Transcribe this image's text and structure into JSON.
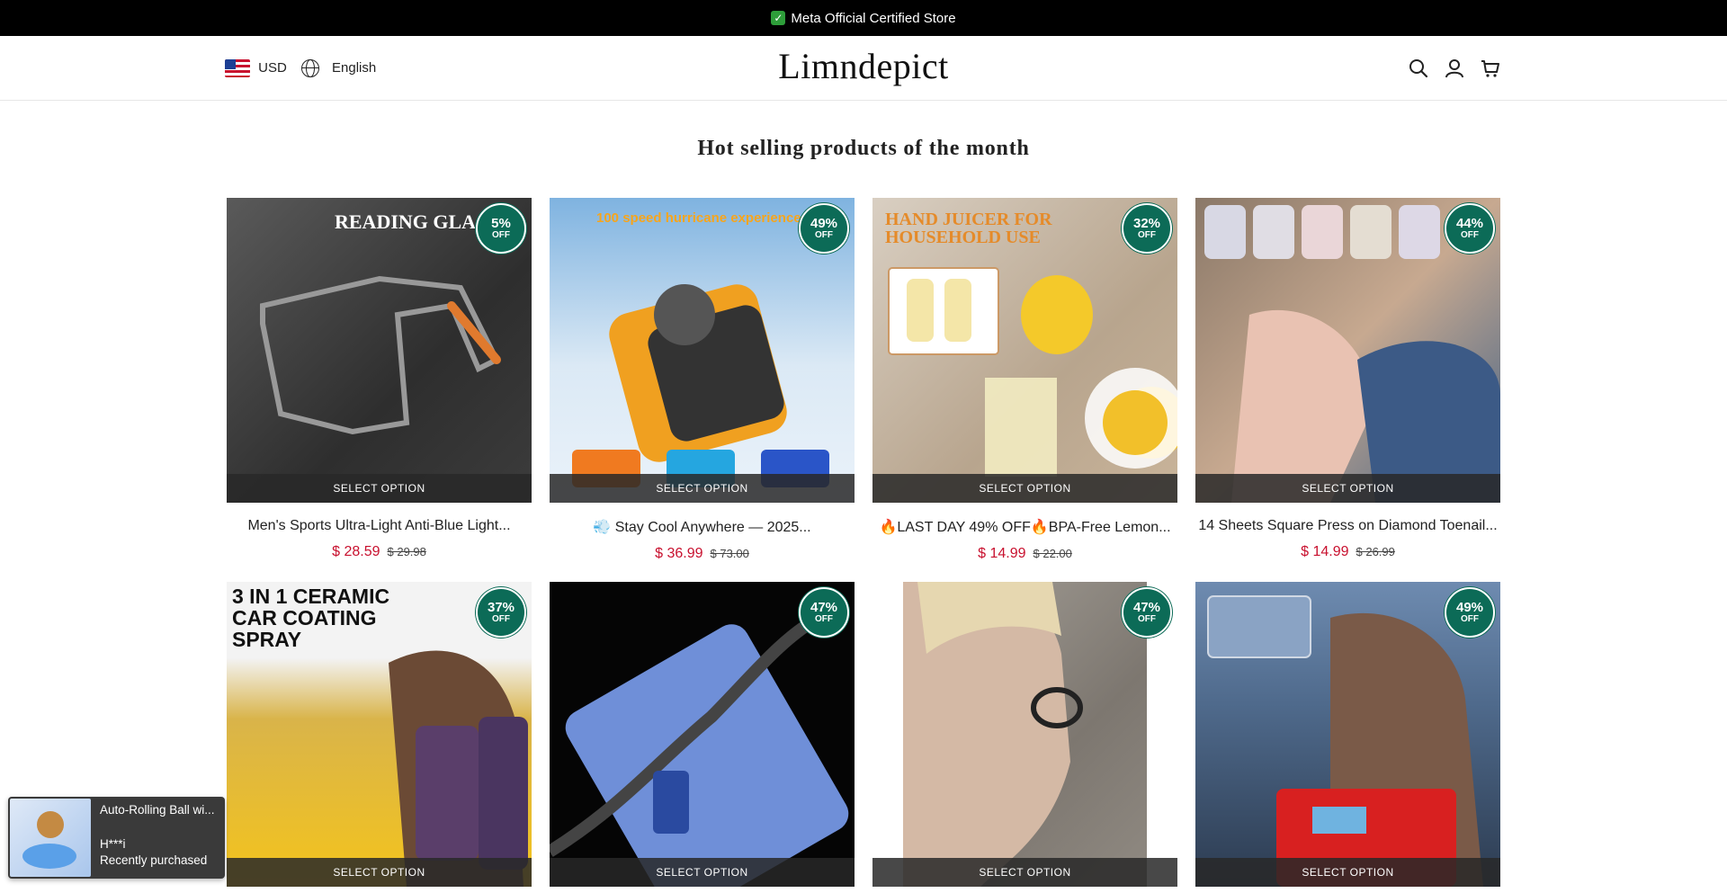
{
  "announcement": {
    "check": "✓",
    "text": "Meta Official Certified Store"
  },
  "header": {
    "currency": "USD",
    "language": "English",
    "logo": "Limndepict"
  },
  "section_title": "Hot selling products of the month",
  "select_label": "SELECT OPTION",
  "off_label": "OFF",
  "products": [
    {
      "title": "Men's Sports Ultra-Light Anti-Blue Light...",
      "price": "$ 28.59",
      "compare": "$ 29.98",
      "discount": "5%",
      "art": "READING GLA..."
    },
    {
      "title": "💨 Stay Cool Anywhere — 2025...",
      "price": "$ 36.99",
      "compare": "$ 73.00",
      "discount": "49%",
      "art": "100 speed hurricane experience"
    },
    {
      "title": "🔥LAST DAY 49% OFF🔥BPA-Free Lemon...",
      "price": "$ 14.99",
      "compare": "$ 22.00",
      "discount": "32%",
      "art": "HAND JUICER FOR HOUSEHOLD USE"
    },
    {
      "title": "14 Sheets Square Press on Diamond Toenail...",
      "price": "$ 14.99",
      "compare": "$ 26.99",
      "discount": "44%",
      "art": ""
    },
    {
      "title": "",
      "price": "",
      "compare": "",
      "discount": "37%",
      "art": "3 IN 1 CERAMIC CAR COATING SPRAY"
    },
    {
      "title": "",
      "price": "",
      "compare": "",
      "discount": "47%",
      "art": ""
    },
    {
      "title": "",
      "price": "",
      "compare": "",
      "discount": "47%",
      "art": ""
    },
    {
      "title": "",
      "price": "",
      "compare": "",
      "discount": "49%",
      "art": ""
    }
  ],
  "popup": {
    "product": "Auto-Rolling Ball wi...",
    "buyer": "H***i",
    "status": "Recently purchased"
  },
  "colors": {
    "badge": "#0c6b57",
    "price": "#c8102e",
    "announce_bg": "#000000"
  }
}
